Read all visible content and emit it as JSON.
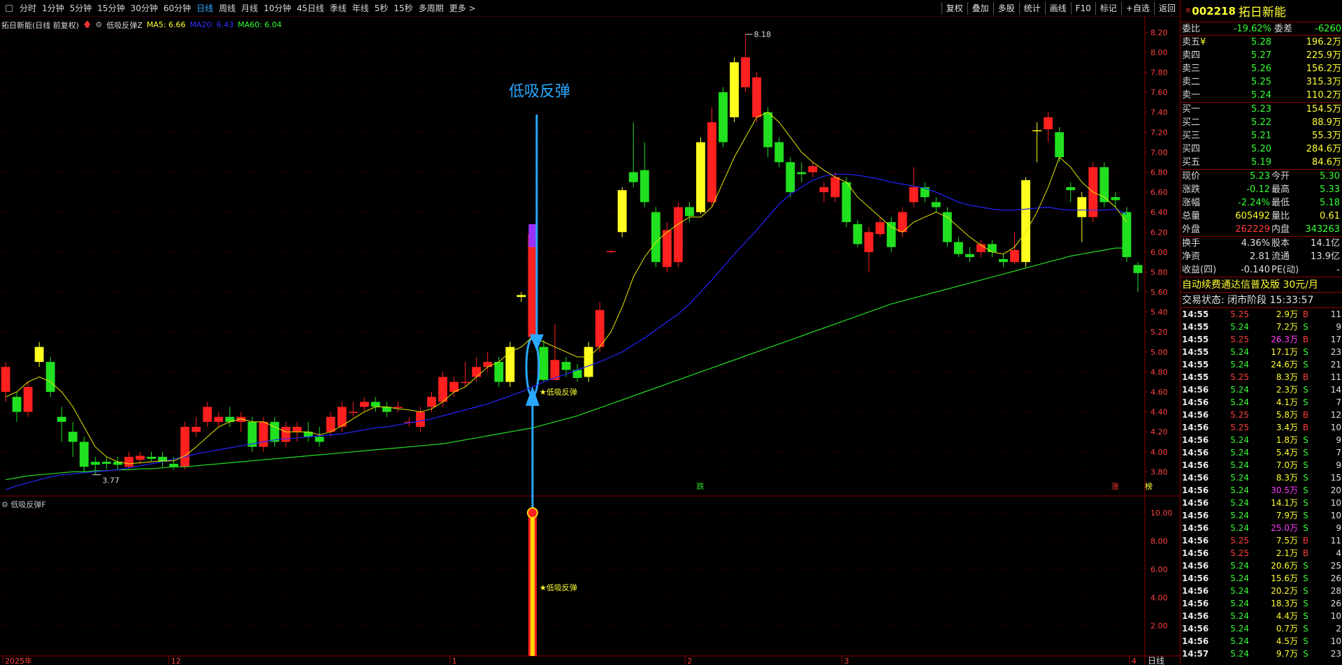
{
  "toolbar": {
    "periods": [
      "分时",
      "1分钟",
      "5分钟",
      "15分钟",
      "30分钟",
      "60分钟",
      "日线",
      "周线",
      "月线",
      "10分钟",
      "45日线",
      "季线",
      "年线",
      "5秒",
      "15秒",
      "多周期",
      "更多 >"
    ],
    "active_period": "日线",
    "tools": [
      "复权",
      "叠加",
      "多股",
      "统计",
      "画线",
      "F10",
      "标记",
      "+自选",
      "返回"
    ]
  },
  "main_chart": {
    "stock_title": "拓日新能(日线 前复权)",
    "indicator_name": "低吸反弹Z",
    "ma_labels": [
      {
        "text": "MA5: 6.66",
        "color": "#ffff33"
      },
      {
        "text": "MA20: 6.43",
        "color": "#3333ff"
      },
      {
        "text": "MA60: 6.04",
        "color": "#33ff33"
      }
    ],
    "sub_indicator_name": "低吸反弹F",
    "annotation_top": "低吸反弹",
    "signal_label": "★低吸反弹",
    "high_label": "8.18",
    "low_label": "3.77",
    "event_labels": [
      "跌",
      "涨",
      "榜"
    ],
    "date_labels": [
      "2025年",
      "12",
      "1",
      "2",
      "3",
      "4"
    ],
    "period_label": "日线"
  },
  "chart_data": {
    "type": "candlestick",
    "price_axis": {
      "ticks": [
        "8.20",
        "8.00",
        "7.80",
        "7.60",
        "7.40",
        "7.20",
        "7.00",
        "6.80",
        "6.60",
        "6.40",
        "6.20",
        "6.00",
        "5.80",
        "5.60",
        "5.40",
        "5.20",
        "5.00",
        "4.80",
        "4.60",
        "4.40",
        "4.20",
        "4.00",
        "3.80"
      ],
      "range": [
        3.6,
        8.3
      ]
    },
    "sub_axis": {
      "ticks": [
        "10.00",
        "8.00",
        "6.00",
        "4.00",
        "2.00"
      ],
      "range": [
        0,
        11
      ]
    },
    "candles": [
      [
        4.6,
        4.85,
        4.9,
        4.5
      ],
      [
        4.55,
        4.4,
        4.6,
        4.3
      ],
      [
        4.4,
        4.65,
        4.7,
        4.35
      ],
      [
        4.9,
        5.05,
        5.1,
        4.85
      ],
      [
        4.9,
        4.6,
        4.95,
        4.55
      ],
      [
        4.35,
        4.3,
        4.45,
        4.1
      ],
      [
        4.2,
        4.1,
        4.3,
        3.95
      ],
      [
        4.1,
        3.85,
        4.15,
        3.8
      ],
      [
        3.9,
        3.87,
        3.95,
        3.77
      ],
      [
        3.9,
        3.88,
        3.95,
        3.82
      ],
      [
        3.9,
        3.87,
        3.95,
        3.82
      ],
      [
        3.85,
        3.95,
        4.0,
        3.82
      ],
      [
        3.92,
        3.96,
        4.0,
        3.88
      ],
      [
        3.95,
        3.93,
        4.0,
        3.9
      ],
      [
        3.95,
        3.9,
        4.0,
        3.85
      ],
      [
        3.88,
        3.85,
        3.95,
        3.82
      ],
      [
        3.85,
        4.25,
        4.3,
        3.82
      ],
      [
        4.2,
        4.25,
        4.35,
        4.15
      ],
      [
        4.3,
        4.45,
        4.5,
        4.25
      ],
      [
        4.3,
        4.35,
        4.4,
        4.25
      ],
      [
        4.35,
        4.3,
        4.45,
        4.25
      ],
      [
        4.3,
        4.35,
        4.4,
        4.2
      ],
      [
        4.3,
        4.05,
        4.35,
        4.0
      ],
      [
        4.05,
        4.3,
        4.35,
        4.0
      ],
      [
        4.3,
        4.1,
        4.35,
        4.05
      ],
      [
        4.1,
        4.25,
        4.3,
        4.05
      ],
      [
        4.2,
        4.25,
        4.3,
        4.1
      ],
      [
        4.2,
        4.15,
        4.3,
        4.1
      ],
      [
        4.15,
        4.1,
        4.25,
        4.05
      ],
      [
        4.2,
        4.35,
        4.4,
        4.15
      ],
      [
        4.25,
        4.45,
        4.5,
        4.2
      ],
      [
        4.4,
        4.4,
        4.5,
        4.35
      ],
      [
        4.45,
        4.5,
        4.55,
        4.4
      ],
      [
        4.5,
        4.45,
        4.55,
        4.4
      ],
      [
        4.45,
        4.4,
        4.5,
        4.35
      ],
      [
        4.45,
        4.45,
        4.5,
        4.4
      ],
      [
        4.3,
        4.3,
        4.35,
        4.25
      ],
      [
        4.25,
        4.4,
        4.45,
        4.2
      ],
      [
        4.45,
        4.55,
        4.6,
        4.4
      ],
      [
        4.5,
        4.75,
        4.8,
        4.45
      ],
      [
        4.6,
        4.7,
        4.75,
        4.55
      ],
      [
        4.7,
        4.7,
        4.9,
        4.65
      ],
      [
        4.75,
        4.85,
        4.95,
        4.7
      ],
      [
        4.85,
        4.9,
        5.0,
        4.8
      ],
      [
        4.9,
        4.7,
        4.95,
        4.65
      ],
      [
        4.7,
        5.05,
        5.1,
        4.65
      ],
      [
        5.55,
        5.57,
        5.6,
        5.5
      ],
      [
        5.15,
        6.18,
        6.2,
        5.1
      ],
      [
        5.05,
        4.72,
        5.12,
        4.7
      ],
      [
        4.72,
        4.92,
        5.28,
        4.72
      ],
      [
        4.9,
        4.82,
        4.95,
        4.75
      ],
      [
        4.82,
        4.74,
        4.88,
        4.7
      ],
      [
        4.75,
        5.05,
        5.1,
        4.7
      ],
      [
        5.05,
        5.42,
        5.5,
        5.0
      ],
      [
        6.0,
        6.01,
        6.02,
        5.99
      ],
      [
        6.2,
        6.62,
        6.65,
        6.15
      ],
      [
        6.8,
        6.7,
        7.3,
        6.65
      ],
      [
        6.82,
        6.5,
        7.1,
        6.45
      ],
      [
        6.4,
        5.9,
        6.45,
        5.85
      ],
      [
        5.85,
        6.22,
        6.3,
        5.8
      ],
      [
        5.9,
        6.45,
        6.5,
        5.85
      ],
      [
        6.45,
        6.36,
        6.5,
        6.3
      ],
      [
        6.4,
        7.1,
        7.15,
        6.38
      ],
      [
        6.5,
        7.3,
        7.45,
        6.45
      ],
      [
        7.6,
        7.1,
        7.65,
        7.05
      ],
      [
        7.9,
        7.35,
        7.95,
        7.3
      ],
      [
        7.65,
        7.95,
        8.18,
        7.6
      ],
      [
        7.35,
        7.75,
        7.8,
        7.3
      ],
      [
        7.4,
        7.05,
        7.45,
        6.95
      ],
      [
        7.1,
        6.9,
        7.15,
        6.85
      ],
      [
        6.9,
        6.6,
        6.95,
        6.55
      ],
      [
        6.8,
        6.78,
        6.9,
        6.7
      ],
      [
        6.8,
        6.86,
        6.9,
        6.75
      ],
      [
        6.6,
        6.65,
        6.7,
        6.5
      ],
      [
        6.55,
        6.75,
        6.8,
        6.5
      ],
      [
        6.7,
        6.3,
        6.75,
        6.25
      ],
      [
        6.28,
        6.08,
        6.32,
        6.05
      ],
      [
        6.0,
        6.2,
        6.25,
        5.8
      ],
      [
        6.18,
        6.3,
        6.35,
        6.15
      ],
      [
        6.3,
        6.05,
        6.35,
        6.0
      ],
      [
        6.2,
        6.4,
        6.45,
        6.15
      ],
      [
        6.5,
        6.65,
        6.85,
        6.45
      ],
      [
        6.65,
        6.55,
        6.7,
        6.5
      ],
      [
        6.5,
        6.45,
        6.55,
        6.4
      ],
      [
        6.4,
        6.1,
        6.45,
        6.05
      ],
      [
        6.1,
        5.98,
        6.15,
        5.95
      ],
      [
        5.98,
        5.95,
        6.05,
        5.9
      ],
      [
        6.0,
        6.08,
        6.12,
        5.95
      ],
      [
        6.08,
        6.0,
        6.12,
        5.95
      ],
      [
        5.93,
        5.9,
        5.98,
        5.85
      ],
      [
        5.9,
        6.02,
        6.2,
        5.88
      ],
      [
        5.9,
        6.72,
        6.75,
        5.85
      ],
      [
        7.22,
        7.22,
        7.3,
        6.9
      ],
      [
        7.23,
        7.35,
        7.4,
        7.1
      ],
      [
        7.2,
        6.95,
        7.25,
        6.9
      ],
      [
        6.65,
        6.62,
        6.7,
        6.5
      ],
      [
        6.55,
        6.35,
        6.6,
        6.1
      ],
      [
        6.35,
        6.85,
        6.9,
        6.3
      ],
      [
        6.85,
        6.5,
        6.9,
        6.45
      ],
      [
        6.55,
        6.52,
        6.6,
        6.45
      ],
      [
        6.4,
        5.95,
        6.45,
        5.9
      ],
      [
        5.87,
        5.79,
        5.9,
        5.6
      ]
    ],
    "ma5": [
      4.55,
      4.6,
      4.7,
      4.75,
      4.7,
      4.6,
      4.45,
      4.25,
      4.05,
      3.95,
      3.9,
      3.88,
      3.89,
      3.9,
      3.91,
      3.91,
      3.96,
      4.05,
      4.15,
      4.25,
      4.3,
      4.33,
      4.3,
      4.3,
      4.25,
      4.2,
      4.2,
      4.2,
      4.17,
      4.2,
      4.26,
      4.33,
      4.4,
      4.45,
      4.45,
      4.43,
      4.42,
      4.4,
      4.43,
      4.5,
      4.6,
      4.65,
      4.75,
      4.85,
      4.9,
      5.0,
      5.05,
      5.15,
      5.1,
      5.05,
      5.0,
      4.95,
      4.95,
      5.05,
      5.2,
      5.45,
      5.75,
      5.95,
      6.1,
      6.2,
      6.28,
      6.35,
      6.35,
      6.45,
      6.7,
      6.95,
      7.15,
      7.35,
      7.4,
      7.3,
      7.15,
      7.0,
      6.9,
      6.82,
      6.75,
      6.7,
      6.55,
      6.45,
      6.35,
      6.25,
      6.2,
      6.3,
      6.35,
      6.4,
      6.35,
      6.25,
      6.15,
      6.07,
      6.0,
      5.98,
      6.05,
      6.2,
      6.4,
      6.65,
      6.95,
      6.85,
      6.7,
      6.6,
      6.55,
      6.45,
      6.3
    ],
    "ma20": [
      3.62,
      3.66,
      3.69,
      3.72,
      3.75,
      3.77,
      3.78,
      3.79,
      3.8,
      3.81,
      3.82,
      3.84,
      3.86,
      3.88,
      3.9,
      3.93,
      3.95,
      3.98,
      4.0,
      4.02,
      4.04,
      4.06,
      4.08,
      4.1,
      4.12,
      4.13,
      4.14,
      4.15,
      4.16,
      4.17,
      4.18,
      4.2,
      4.22,
      4.24,
      4.25,
      4.27,
      4.29,
      4.31,
      4.33,
      4.36,
      4.39,
      4.42,
      4.45,
      4.48,
      4.52,
      4.56,
      4.6,
      4.65,
      4.7,
      4.74,
      4.78,
      4.82,
      4.86,
      4.9,
      4.95,
      5.0,
      5.07,
      5.14,
      5.22,
      5.3,
      5.38,
      5.48,
      5.6,
      5.72,
      5.85,
      5.98,
      6.1,
      6.22,
      6.35,
      6.48,
      6.58,
      6.65,
      6.72,
      6.76,
      6.78,
      6.78,
      6.77,
      6.75,
      6.73,
      6.7,
      6.68,
      6.66,
      6.64,
      6.6,
      6.55,
      6.5,
      6.47,
      6.45,
      6.43,
      6.42,
      6.42,
      6.43,
      6.44,
      6.45,
      6.43,
      6.42,
      6.42,
      6.42,
      6.42,
      6.43,
      6.38
    ],
    "ma60": [
      3.72,
      3.74,
      3.76,
      3.77,
      3.78,
      3.79,
      3.8,
      3.8,
      3.81,
      3.81,
      3.82,
      3.82,
      3.83,
      3.83,
      3.84,
      3.85,
      3.85,
      3.86,
      3.87,
      3.88,
      3.89,
      3.9,
      3.91,
      3.92,
      3.93,
      3.94,
      3.95,
      3.96,
      3.97,
      3.98,
      3.99,
      4.0,
      4.01,
      4.02,
      4.03,
      4.04,
      4.05,
      4.06,
      4.07,
      4.08,
      4.1,
      4.12,
      4.14,
      4.16,
      4.18,
      4.2,
      4.22,
      4.24,
      4.27,
      4.3,
      4.33,
      4.36,
      4.4,
      4.44,
      4.48,
      4.52,
      4.56,
      4.6,
      4.64,
      4.68,
      4.72,
      4.76,
      4.8,
      4.84,
      4.88,
      4.92,
      4.96,
      5.0,
      5.04,
      5.08,
      5.12,
      5.16,
      5.2,
      5.24,
      5.28,
      5.32,
      5.36,
      5.4,
      5.44,
      5.48,
      5.51,
      5.54,
      5.57,
      5.6,
      5.63,
      5.66,
      5.69,
      5.72,
      5.75,
      5.78,
      5.81,
      5.84,
      5.87,
      5.9,
      5.93,
      5.96,
      5.98,
      6.0,
      6.02,
      6.04,
      6.04
    ],
    "signal_index": 47,
    "signal_value": 10
  },
  "quote_panel": {
    "code": "002218",
    "name": "拓日新能",
    "r_mark": "R",
    "wei_label": "委比",
    "wei_bi": "-19.62%",
    "wei_cha_label": "委差",
    "wei_cha": "-6260",
    "asks": [
      {
        "label": "卖五",
        "mark": "¥",
        "price": "5.28",
        "vol": "196.2万"
      },
      {
        "label": "卖四",
        "mark": "",
        "price": "5.27",
        "vol": "225.9万"
      },
      {
        "label": "卖三",
        "mark": "",
        "price": "5.26",
        "vol": "156.2万"
      },
      {
        "label": "卖二",
        "mark": "",
        "price": "5.25",
        "vol": "315.3万"
      },
      {
        "label": "卖一",
        "mark": "",
        "price": "5.24",
        "vol": "110.2万"
      }
    ],
    "bids": [
      {
        "label": "买一",
        "price": "5.23",
        "vol": "154.5万"
      },
      {
        "label": "买二",
        "price": "5.22",
        "vol": "88.9万"
      },
      {
        "label": "买三",
        "price": "5.21",
        "vol": "55.3万"
      },
      {
        "label": "买四",
        "price": "5.20",
        "vol": "284.6万"
      },
      {
        "label": "买五",
        "price": "5.19",
        "vol": "84.6万"
      }
    ],
    "stats": [
      [
        {
          "k": "现价",
          "v": "5.23",
          "c": "dn"
        },
        {
          "k": "今开",
          "v": "5.30",
          "c": "dn"
        }
      ],
      [
        {
          "k": "涨跌",
          "v": "-0.12",
          "c": "dn"
        },
        {
          "k": "最高",
          "v": "5.33",
          "c": "dn"
        }
      ],
      [
        {
          "k": "涨幅",
          "v": "-2.24%",
          "c": "dn"
        },
        {
          "k": "最低",
          "v": "5.18",
          "c": "dn"
        }
      ],
      [
        {
          "k": "总量",
          "v": "605492",
          "c": "ye"
        },
        {
          "k": "量比",
          "v": "0.61",
          "c": "ye"
        }
      ],
      [
        {
          "k": "外盘",
          "v": "262229",
          "c": "up"
        },
        {
          "k": "内盘",
          "v": "343263",
          "c": "dn"
        }
      ]
    ],
    "stats2": [
      [
        {
          "k": "换手",
          "v": "4.36%",
          "c": "wh"
        },
        {
          "k": "股本",
          "v": "14.1亿",
          "c": "wh"
        }
      ],
      [
        {
          "k": "净资",
          "v": "2.81",
          "c": "wh"
        },
        {
          "k": "流通",
          "v": "13.9亿",
          "c": "wh"
        }
      ],
      [
        {
          "k": "收益(四)",
          "v": "-0.140",
          "c": "wh"
        },
        {
          "k": "PE(动)",
          "v": "-",
          "c": "wh"
        }
      ]
    ],
    "promo": "自动续费通达信普及版 30元/月",
    "status_text": "交易状态: 闭市阶段 15:33:57",
    "ticks": [
      [
        "14:55",
        "5.25",
        "2.9万",
        "B",
        "11"
      ],
      [
        "14:55",
        "5.24",
        "7.2万",
        "S",
        "9"
      ],
      [
        "14:55",
        "5.25",
        "26.3万",
        "B",
        "17"
      ],
      [
        "14:55",
        "5.24",
        "17.1万",
        "S",
        "23"
      ],
      [
        "14:55",
        "5.24",
        "24.6万",
        "S",
        "21"
      ],
      [
        "14:55",
        "5.25",
        "8.3万",
        "B",
        "11"
      ],
      [
        "14:56",
        "5.24",
        "2.3万",
        "S",
        "14"
      ],
      [
        "14:56",
        "5.24",
        "4.1万",
        "S",
        "7"
      ],
      [
        "14:56",
        "5.25",
        "5.8万",
        "B",
        "12"
      ],
      [
        "14:56",
        "5.25",
        "3.4万",
        "B",
        "10"
      ],
      [
        "14:56",
        "5.24",
        "1.8万",
        "S",
        "9"
      ],
      [
        "14:56",
        "5.24",
        "5.4万",
        "S",
        "7"
      ],
      [
        "14:56",
        "5.24",
        "7.0万",
        "S",
        "9"
      ],
      [
        "14:56",
        "5.24",
        "8.3万",
        "S",
        "15"
      ],
      [
        "14:56",
        "5.24",
        "30.5万",
        "S",
        "20"
      ],
      [
        "14:56",
        "5.24",
        "14.1万",
        "S",
        "10"
      ],
      [
        "14:56",
        "5.24",
        "7.9万",
        "S",
        "10"
      ],
      [
        "14:56",
        "5.24",
        "25.0万",
        "S",
        "9"
      ],
      [
        "14:56",
        "5.25",
        "7.5万",
        "B",
        "11"
      ],
      [
        "14:56",
        "5.25",
        "2.1万",
        "B",
        "4"
      ],
      [
        "14:56",
        "5.24",
        "20.6万",
        "S",
        "25"
      ],
      [
        "14:56",
        "5.24",
        "15.6万",
        "S",
        "26"
      ],
      [
        "14:56",
        "5.24",
        "20.2万",
        "S",
        "28"
      ],
      [
        "14:56",
        "5.24",
        "18.3万",
        "S",
        "26"
      ],
      [
        "14:56",
        "5.24",
        "4.4万",
        "S",
        "10"
      ],
      [
        "14:56",
        "5.24",
        "0.7万",
        "S",
        "2"
      ],
      [
        "14:56",
        "5.24",
        "4.5万",
        "S",
        "10"
      ],
      [
        "14:57",
        "5.24",
        "9.7万",
        "S",
        "23"
      ]
    ]
  }
}
